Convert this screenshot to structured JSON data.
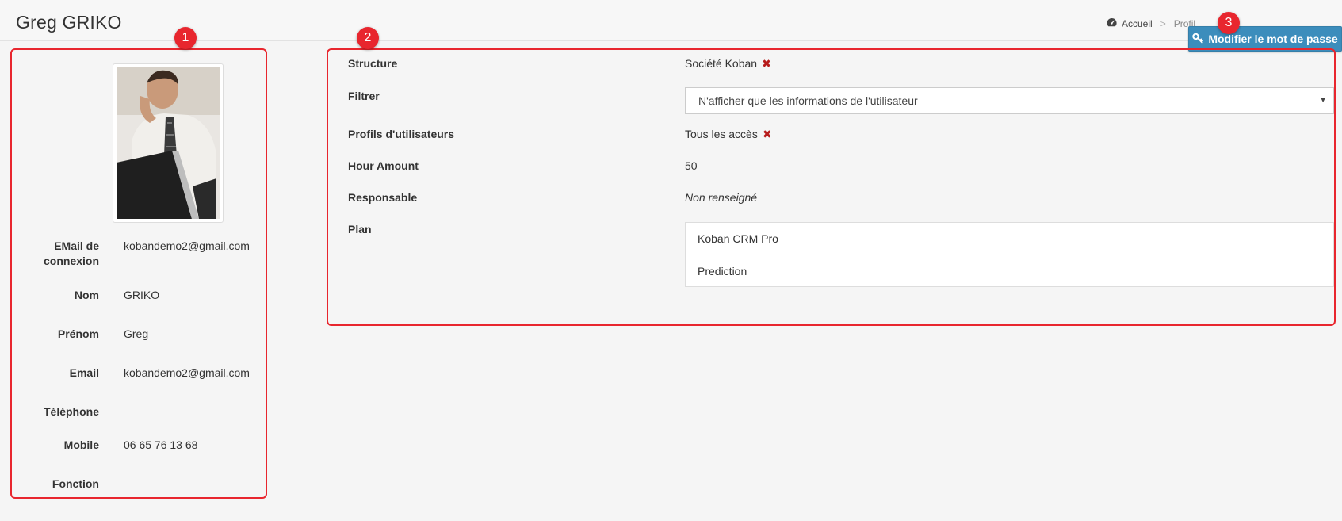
{
  "header": {
    "title": "Greg GRIKO",
    "breadcrumb": {
      "home": "Accueil",
      "separator": ">",
      "current": "Profil"
    },
    "change_password_label": "Modifier le mot de passe"
  },
  "annotations": {
    "badge1": "1",
    "badge2": "2",
    "badge3": "3",
    "color": "#e8262e"
  },
  "profile": {
    "fields": [
      {
        "label": "EMail de connexion",
        "value": "kobandemo2@gmail.com"
      },
      {
        "label": "Nom",
        "value": "GRIKO"
      },
      {
        "label": "Prénom",
        "value": "Greg"
      },
      {
        "label": "Email",
        "value": "kobandemo2@gmail.com"
      },
      {
        "label": "Téléphone",
        "value": ""
      },
      {
        "label": "Mobile",
        "value": "06 65 76 13 68"
      },
      {
        "label": "Fonction",
        "value": ""
      }
    ]
  },
  "details": {
    "structure": {
      "label": "Structure",
      "value": "Société Koban"
    },
    "filtrer": {
      "label": "Filtrer",
      "value": "N'afficher que les informations de l'utilisateur"
    },
    "profils": {
      "label": "Profils d'utilisateurs",
      "value": "Tous les accès"
    },
    "hour_amount": {
      "label": "Hour Amount",
      "value": "50"
    },
    "responsable": {
      "label": "Responsable",
      "value": "Non renseigné"
    },
    "plan": {
      "label": "Plan",
      "items": [
        "Koban CRM Pro",
        "Prediction"
      ]
    }
  },
  "colors": {
    "button": "#3c8dbc",
    "remove_icon": "#b71c1c"
  }
}
